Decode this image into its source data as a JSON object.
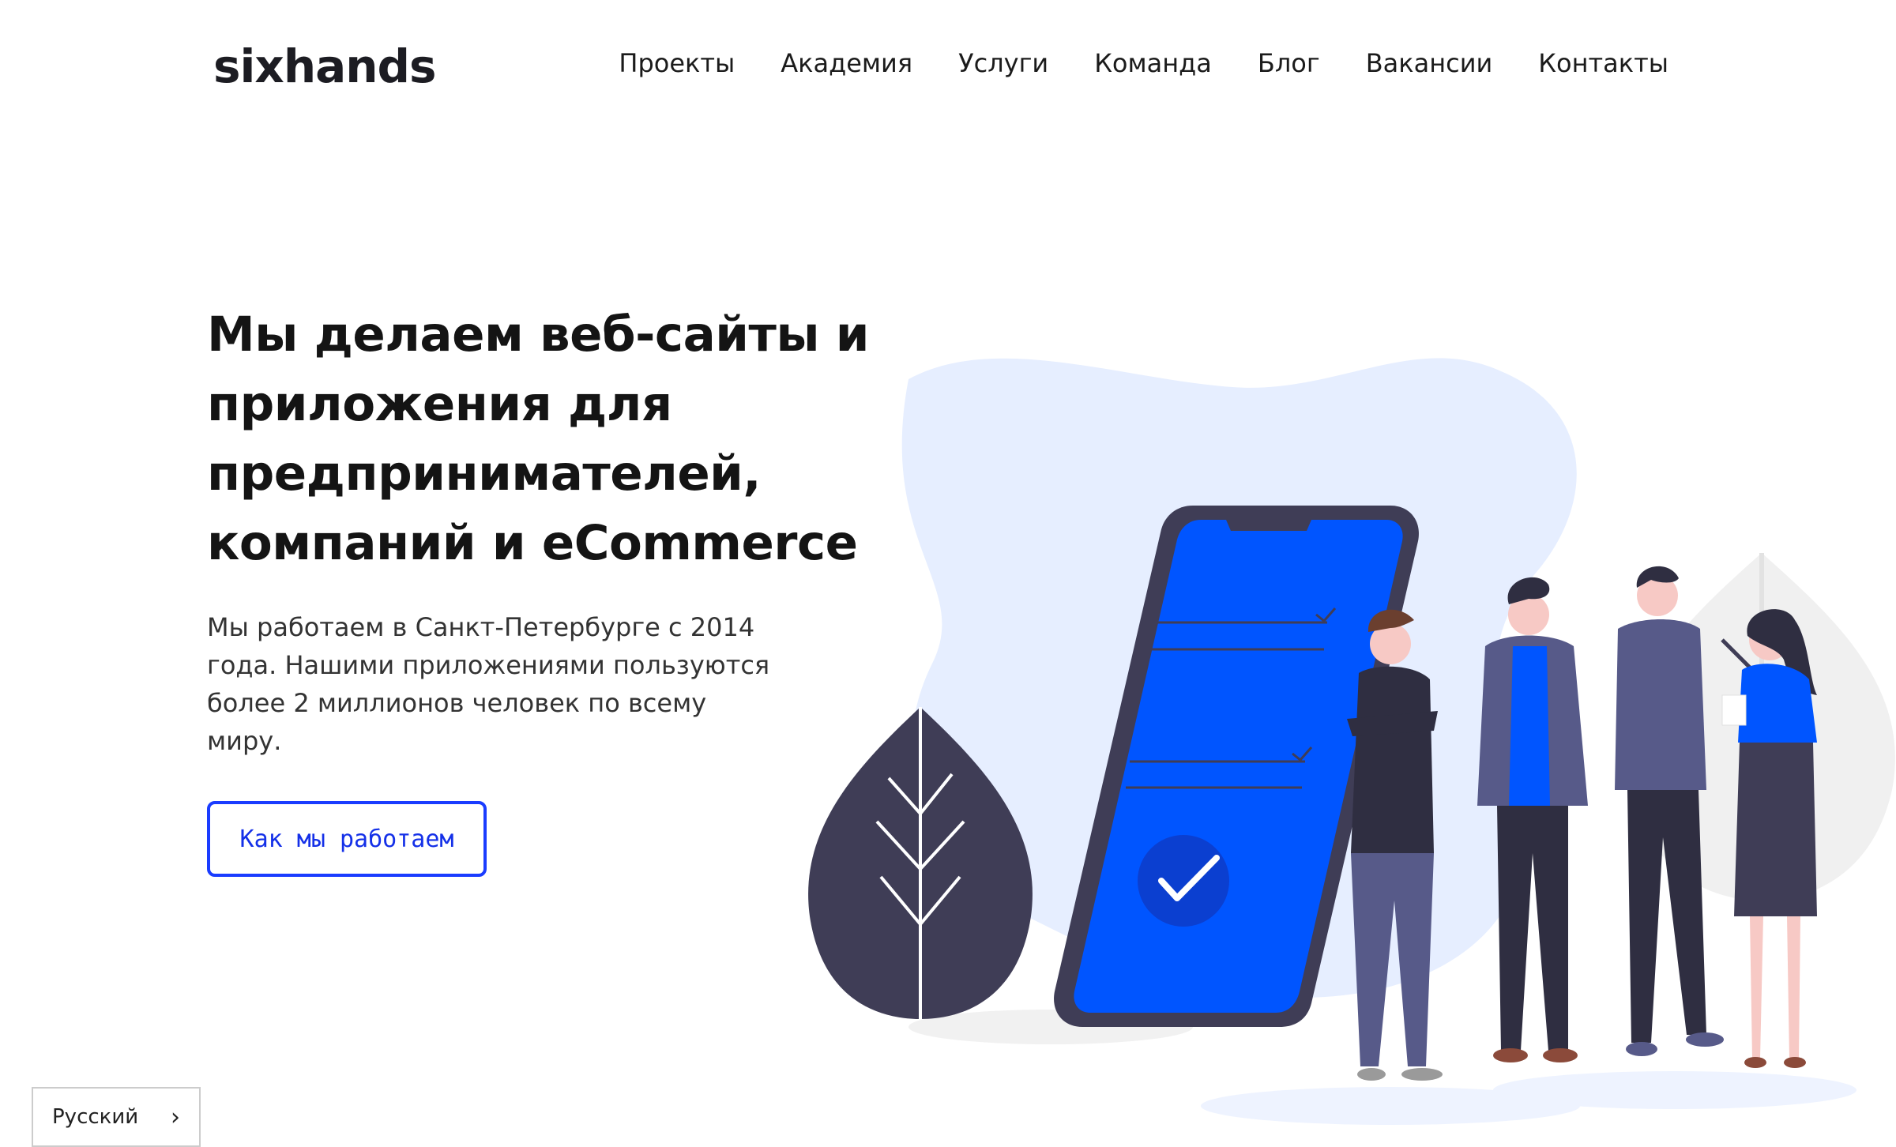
{
  "header": {
    "logo": "sixhands",
    "nav": [
      {
        "label": "Проекты"
      },
      {
        "label": "Академия"
      },
      {
        "label": "Услуги"
      },
      {
        "label": "Команда"
      },
      {
        "label": "Блог"
      },
      {
        "label": "Вакансии"
      },
      {
        "label": "Контакты"
      }
    ]
  },
  "hero": {
    "title_lines": [
      "Мы делаем веб-сайты и",
      "приложения для",
      "предпринимателей,",
      "компаний и eCommerce"
    ],
    "description": "Мы работаем в Санкт-Петербурге с 2014 года. Нашими приложениями пользуются более 2 миллионов человек по всему миру.",
    "cta_label": "Как мы работаем"
  },
  "language": {
    "selected": "Русский",
    "chevron_icon": "chevron-right-icon"
  },
  "colors": {
    "accent": "#0055ff",
    "cta_border": "#1a3cff",
    "blob": "#e6eeff",
    "dark": "#3f3d56"
  },
  "illustration": {
    "icons": [
      "leaf-icon",
      "phone-icon",
      "checkmark-icon",
      "people-icon"
    ]
  }
}
